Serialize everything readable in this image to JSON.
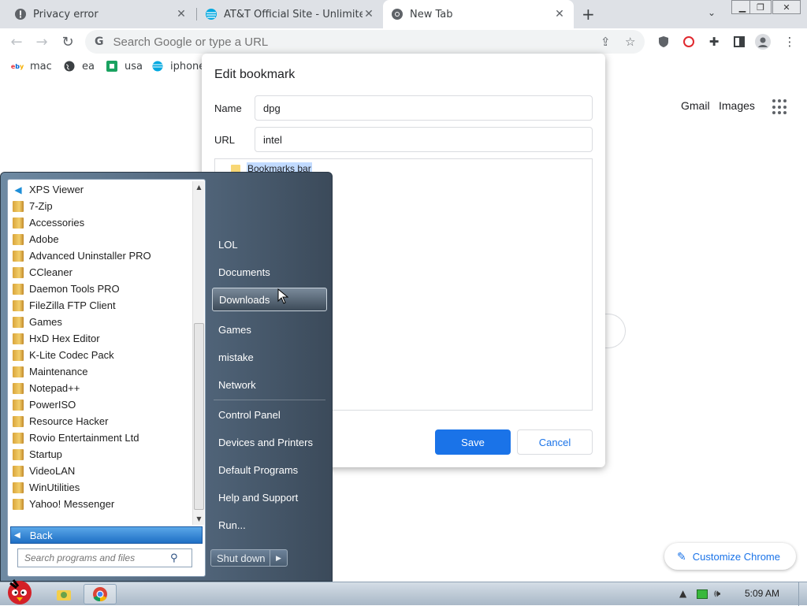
{
  "browser": {
    "tabs": [
      {
        "title": "Privacy error",
        "icon": "warning-icon",
        "active": false
      },
      {
        "title": "AT&T Official Site - Unlimited",
        "icon": "att-globe-icon",
        "active": false
      },
      {
        "title": "New Tab",
        "icon": "chrome-icon",
        "active": true
      }
    ],
    "omnibox": {
      "placeholder": "Search Google or type a URL",
      "icon": "google-g-icon"
    },
    "bookmarks_bar": [
      {
        "label": "mac",
        "icon": "ebay-icon"
      },
      {
        "label": "ea",
        "icon": "globe-icon"
      },
      {
        "label": "usa",
        "icon": "usa-icon"
      },
      {
        "label": "iphone",
        "icon": "att-globe-icon"
      }
    ],
    "ntp": {
      "gmail": "Gmail",
      "images": "Images",
      "customize": "Customize Chrome"
    }
  },
  "dialog": {
    "title": "Edit bookmark",
    "name_label": "Name",
    "name_value": "dpg",
    "url_label": "URL",
    "url_value": "intel",
    "folder": "Bookmarks bar",
    "save": "Save",
    "cancel": "Cancel"
  },
  "start_menu": {
    "programs": [
      {
        "label": "XPS Viewer",
        "icon": "xps-icon"
      },
      {
        "label": "7-Zip",
        "icon": "folder-icon"
      },
      {
        "label": "Accessories",
        "icon": "folder-icon"
      },
      {
        "label": "Adobe",
        "icon": "folder-icon"
      },
      {
        "label": "Advanced Uninstaller PRO",
        "icon": "folder-icon"
      },
      {
        "label": "CCleaner",
        "icon": "folder-icon"
      },
      {
        "label": "Daemon Tools PRO",
        "icon": "folder-icon"
      },
      {
        "label": "FileZilla FTP Client",
        "icon": "folder-icon"
      },
      {
        "label": "Games",
        "icon": "folder-icon"
      },
      {
        "label": "HxD Hex Editor",
        "icon": "folder-icon"
      },
      {
        "label": "K-Lite Codec Pack",
        "icon": "folder-icon"
      },
      {
        "label": "Maintenance",
        "icon": "folder-icon"
      },
      {
        "label": "Notepad++",
        "icon": "folder-icon"
      },
      {
        "label": "PowerISO",
        "icon": "folder-icon"
      },
      {
        "label": "Resource Hacker",
        "icon": "folder-icon"
      },
      {
        "label": "Rovio Entertainment Ltd",
        "icon": "folder-icon"
      },
      {
        "label": "Startup",
        "icon": "folder-icon"
      },
      {
        "label": "VideoLAN",
        "icon": "folder-icon"
      },
      {
        "label": "WinUtilities",
        "icon": "folder-icon"
      },
      {
        "label": "Yahoo! Messenger",
        "icon": "folder-icon"
      }
    ],
    "back": "Back",
    "search_placeholder": "Search programs and files",
    "right_links": [
      "LOL",
      "Documents",
      "Downloads",
      "Games",
      "mistake",
      "Network",
      "Control Panel",
      "Devices and Printers",
      "Default Programs",
      "Help and Support",
      "Run..."
    ],
    "highlighted": "Downloads",
    "shutdown": "Shut down"
  },
  "taskbar": {
    "clock": "5:09 AM"
  },
  "colors": {
    "chrome_blue": "#1a73e8",
    "start_highlight": "#1f6fc5"
  }
}
